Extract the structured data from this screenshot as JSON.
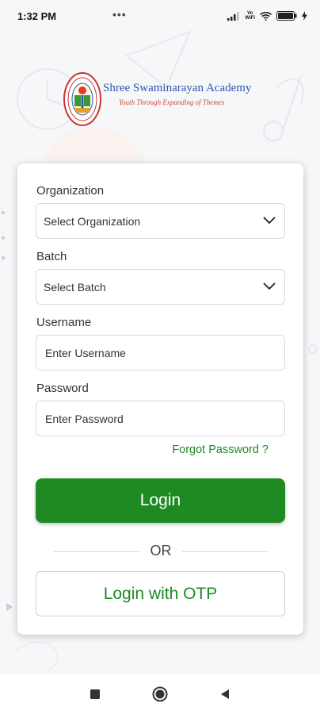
{
  "status_bar": {
    "time": "1:32 PM",
    "dots": "•••",
    "network_top": "Vo",
    "network_bottom": "WiFi"
  },
  "logo": {
    "title": "Shree Swaminarayan Academy",
    "tagline": "Youth Through Expanding of Themes"
  },
  "form": {
    "organization_label": "Organization",
    "organization_value": "Select Organization",
    "batch_label": "Batch",
    "batch_value": "Select Batch",
    "username_label": "Username",
    "username_placeholder": "Enter Username",
    "password_label": "Password",
    "password_placeholder": "Enter Password",
    "forgot_password": "Forgot Password ?",
    "login_label": "Login",
    "or_text": "OR",
    "otp_label": "Login with OTP"
  },
  "colors": {
    "primary_green": "#1f8a23",
    "logo_blue": "#2f56b0",
    "logo_red": "#d24a32"
  },
  "nav_bar": {
    "icons": [
      "square-recents-icon",
      "circle-home-icon",
      "triangle-back-icon"
    ]
  }
}
